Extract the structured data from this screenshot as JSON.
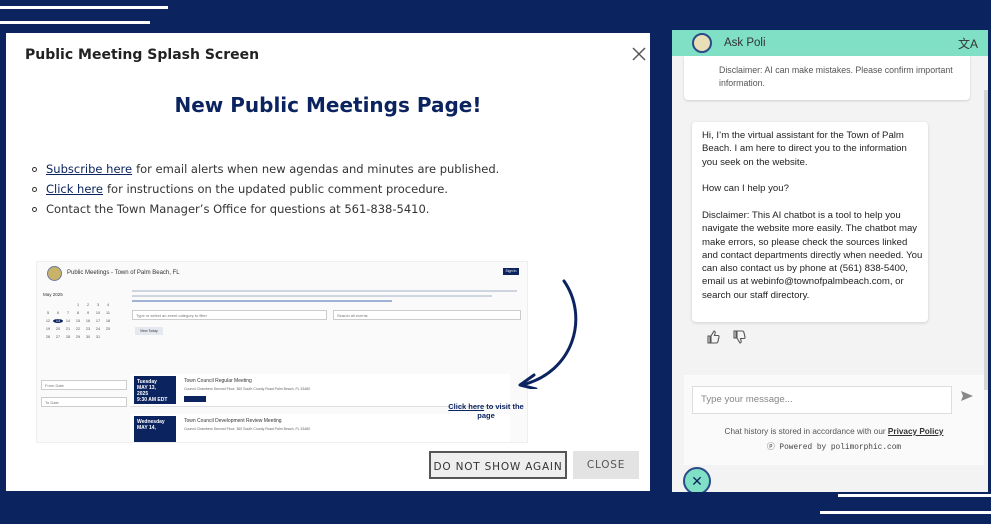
{
  "modal": {
    "title": "Public Meeting Splash Screen",
    "heading": "New Public Meetings Page!",
    "bullets": [
      {
        "link": "Subscribe here",
        "text": "for email alerts when new agendas and minutes are published."
      },
      {
        "link": "Click here",
        "text": "for instructions on the updated public comment procedure."
      },
      {
        "link": "",
        "text": "Contact the Town Manager’s Office for questions at 561-838-5410."
      }
    ],
    "preview": {
      "site_title": "Public Meetings - Town of Palm Beach, FL",
      "signin": "Sign In",
      "month": "May 2025",
      "days": [
        "",
        "",
        "",
        "1",
        "2",
        "3",
        "4",
        "5",
        "6",
        "7",
        "8",
        "9",
        "10",
        "11",
        "12",
        "13",
        "14",
        "15",
        "16",
        "17",
        "18",
        "19",
        "20",
        "21",
        "22",
        "23",
        "24",
        "25",
        "26",
        "27",
        "28",
        "29",
        "30",
        "31",
        ""
      ],
      "from_date": "From Date",
      "to_date": "To Date",
      "category_placeholder": "Type or select an event category to filter",
      "search_placeholder": "Search all events",
      "view_today": "View Today",
      "events": [
        {
          "date": "Tuesday\nMAY 13,\n2025\n9:30 AM EDT",
          "title": "Town Council Regular Meeting",
          "location": "Council Chambers Second Floor, 360 South County Road Palm Beach, FL 33480"
        },
        {
          "date": "Wednesday\nMAY 14,",
          "title": "Town Council Development Review Meeting",
          "location": "Council Chambers Second Floor, 360 South County Road Palm Beach, FL 33480"
        }
      ],
      "callout_link": "Click here",
      "callout_text": "to visit the page"
    },
    "btn_dont_show": "DO NOT SHOW AGAIN",
    "btn_close": "CLOSE"
  },
  "chat": {
    "name": "Ask Poli",
    "disclaimer_top": "Disclaimer: AI can make mistakes. Please confirm important information.",
    "msg_intro": "Hi, I’m the virtual assistant for the Town of Palm Beach. I am here to direct you to the information you seek on the website.",
    "msg_help": "How can I help you?",
    "msg_disclaimer": "Disclaimer: This AI chatbot is a tool to help you navigate the website more easily. The chatbot may make errors, so please check the sources linked and contact departments directly when needed. You can also contact us by phone at (561) 838-5400, email us at webinfo@townofpalmbeach.com, or search our staff directory.",
    "input_placeholder": "Type your message...",
    "history_text": "Chat history is stored in accordance with our",
    "privacy_link": "Privacy Policy",
    "powered": "Powered by polimorphic.com"
  },
  "colors": {
    "navy": "#0b2460",
    "accent": "#7fe0c5"
  },
  "icons": [
    "close-icon",
    "translate-icon",
    "thumbs-up-icon",
    "thumbs-down-icon",
    "send-icon",
    "curved-arrow-icon"
  ]
}
